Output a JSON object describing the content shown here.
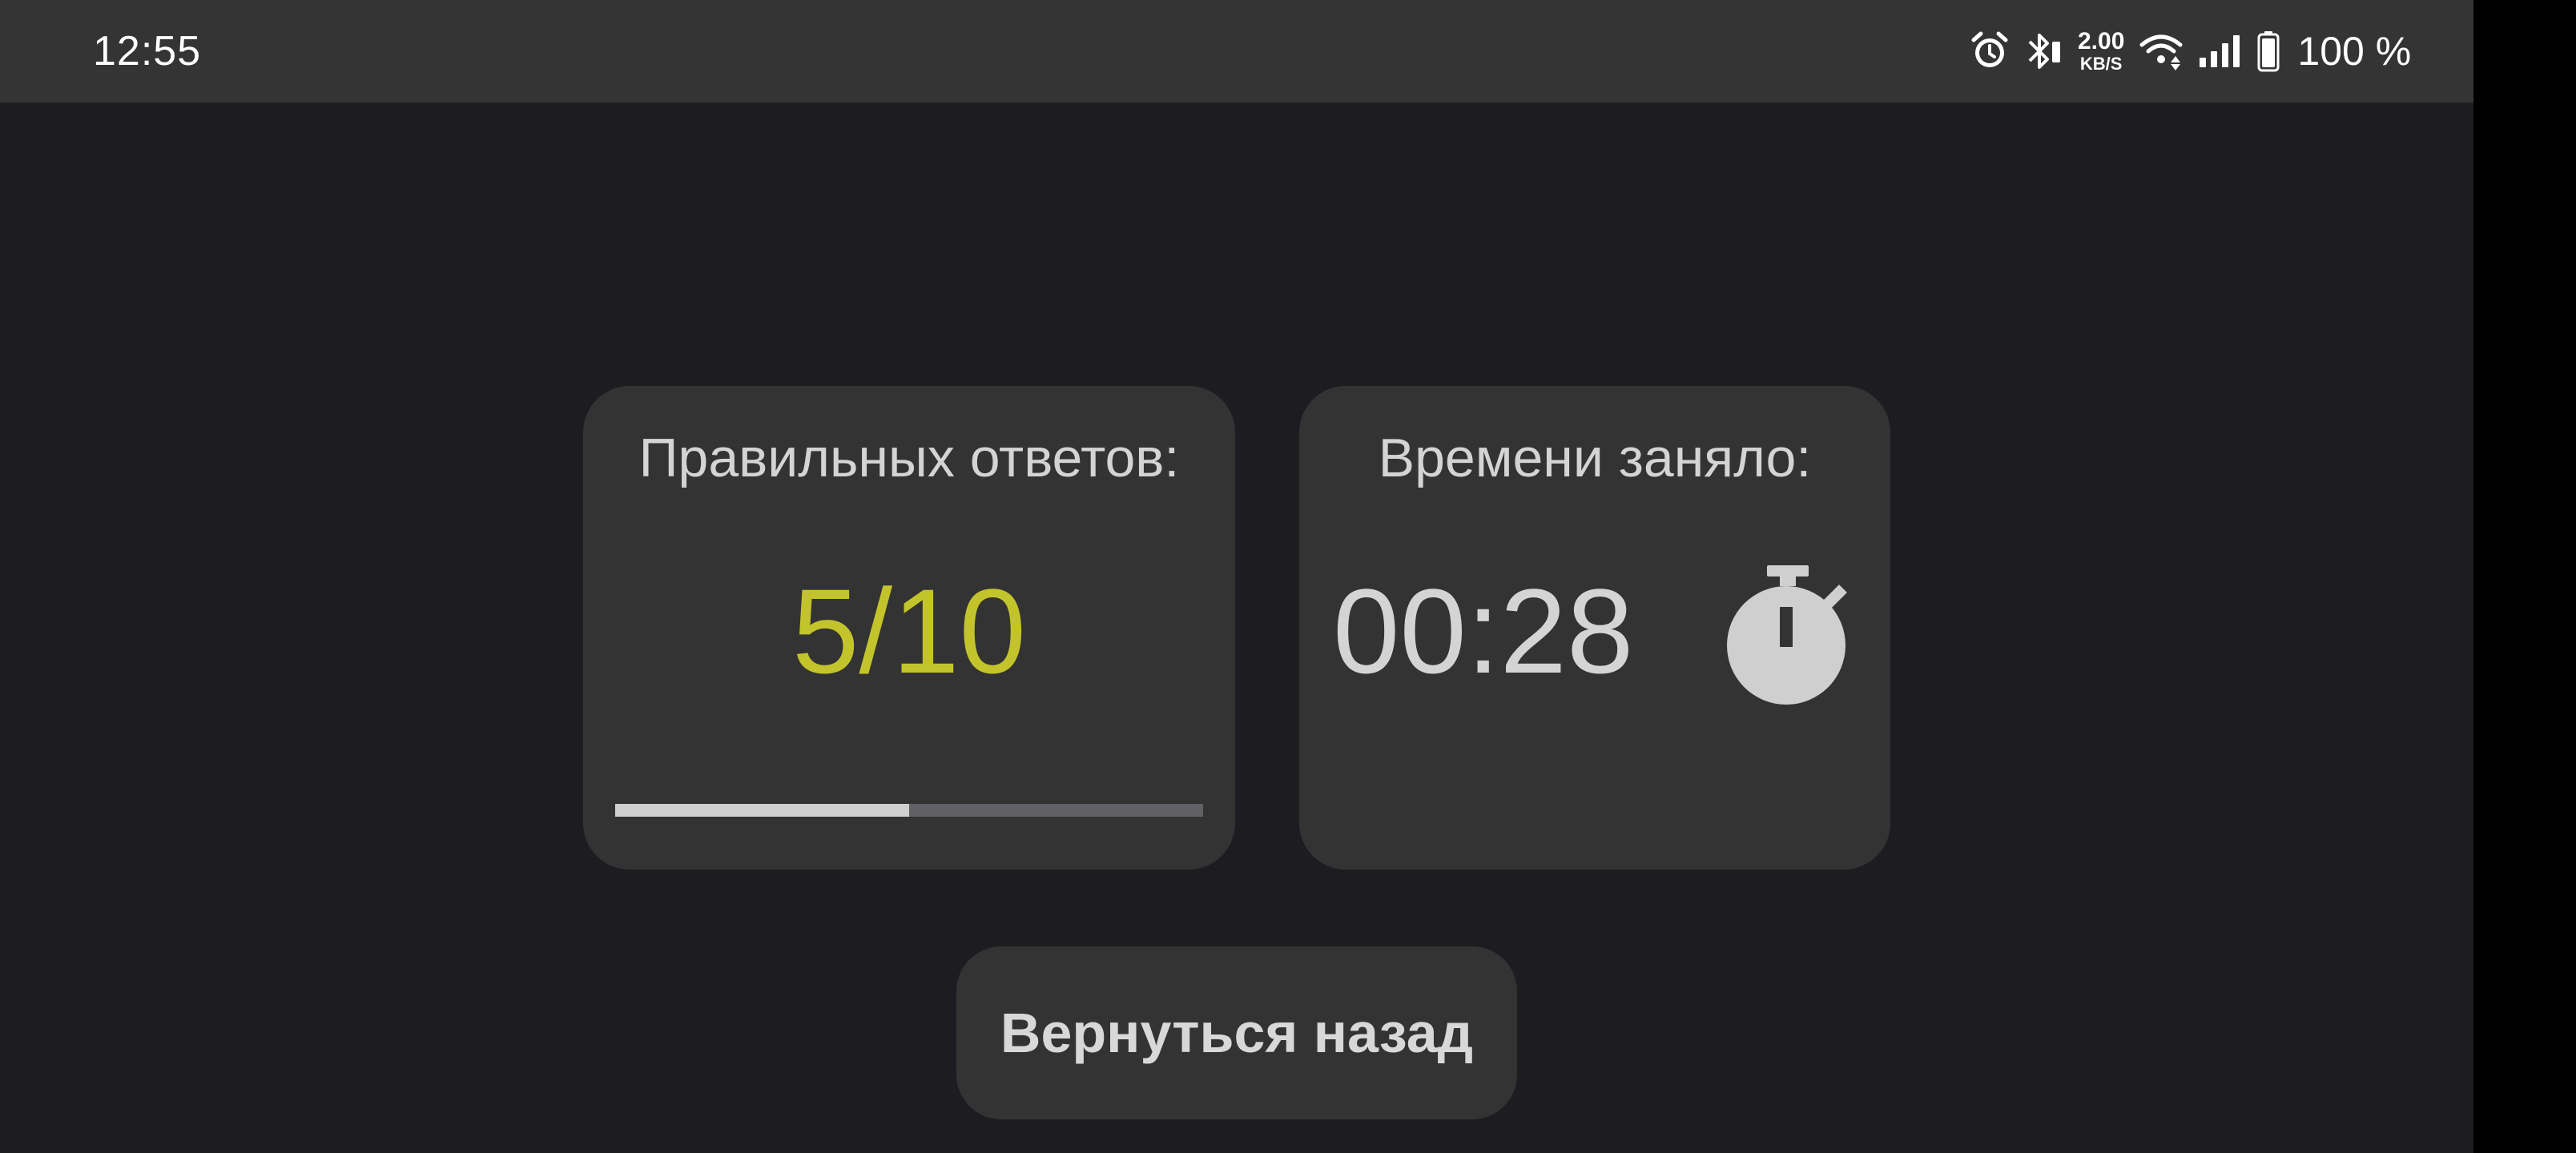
{
  "status_bar": {
    "time": "12:55",
    "net_speed_value": "2.00",
    "net_speed_unit": "KB/S",
    "battery_percent": "100 %",
    "icons": [
      "alarm-icon",
      "bluetooth-icon",
      "wifi-icon",
      "signal-icon",
      "battery-icon"
    ]
  },
  "results": {
    "correct": {
      "title": "Правильных ответов:",
      "score_text": "5/10",
      "progress_fraction": 0.5
    },
    "time": {
      "title": "Времени заняло:",
      "elapsed": "00:28",
      "icon": "stopwatch-icon"
    }
  },
  "actions": {
    "back_label": "Вернуться назад"
  },
  "colors": {
    "background": "#1d1d21",
    "card": "#333333",
    "score_accent": "#c3c42c",
    "text": "#d4d4d4"
  }
}
